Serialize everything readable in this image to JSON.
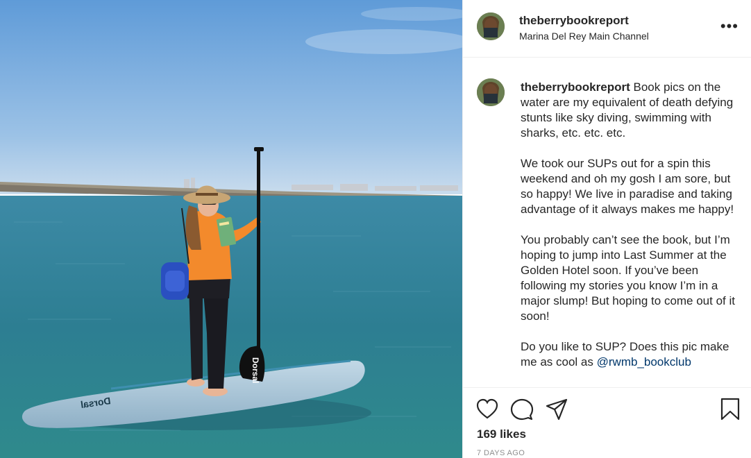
{
  "post": {
    "username": "theberrybookreport",
    "location": "Marina Del Rey Main Channel",
    "more_label": "•••",
    "photo_alt": "Woman standing on a paddleboard holding a paddle and a book on the water",
    "paddle_brand": "Dorsal",
    "board_brand": "Dorsal"
  },
  "caption": {
    "username": "theberrybookreport",
    "p1": "Book pics on the water are my equivalent of death defying stunts like sky diving, swimming with sharks, etc. etc. etc.",
    "p2": "We took our SUPs out for a spin this weekend and oh my gosh I am sore, but so happy! We live in paradise and taking advantage of it always makes me happy!",
    "p3": "You probably can’t see the book, but I’m hoping to jump into Last Summer at the Golden Hotel soon. If you’ve been following my stories you know I’m in a major slump! But hoping to come out of it soon!",
    "p4": "Do you like to SUP? Does this pic make me as cool as",
    "mention": "@rwmb_bookclub"
  },
  "actions": {
    "likes": "169 likes",
    "date": "7 DAYS AGO",
    "icons": [
      "heart-icon",
      "comment-icon",
      "share-icon",
      "bookmark-icon"
    ]
  },
  "colors": {
    "sky_top": "#5f9bd8",
    "water": "#2d7e92",
    "board": "#a9c6d8",
    "shirt": "#f38a2c",
    "mention": "#00376b"
  }
}
